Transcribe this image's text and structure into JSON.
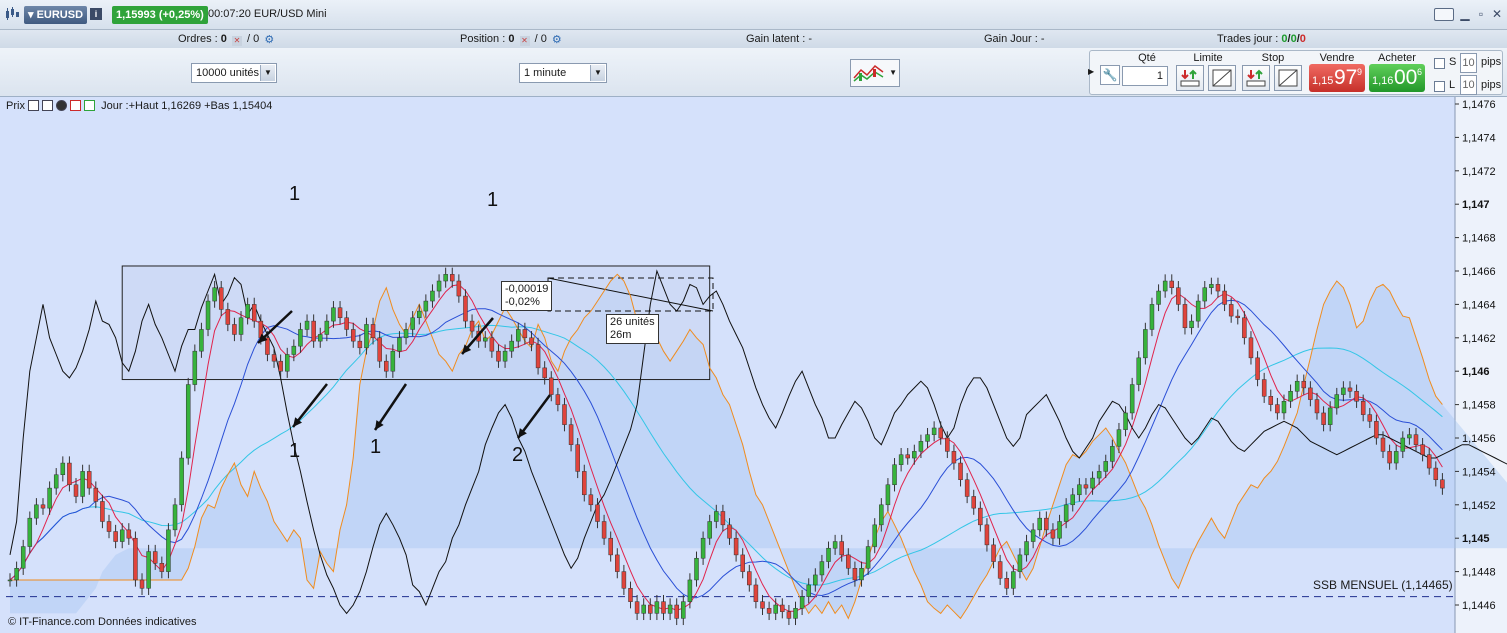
{
  "window": {
    "symbol": "EURUSD",
    "price_badge": "1,15993 (+0,25%)",
    "time_title": "00:07:20 EUR/USD Mini",
    "colors": {
      "up": "#2fa33a",
      "down": "#cc2a2a"
    }
  },
  "status": {
    "orders_label": "Ordres :",
    "orders_a": "0",
    "orders_sep": "/",
    "orders_b": "0",
    "position_label": "Position :",
    "position_a": "0",
    "position_sep": "/",
    "position_b": "0",
    "latent_label": "Gain latent :",
    "latent_value": "-",
    "day_gain_label": "Gain Jour :",
    "day_gain_value": "-",
    "trades_label": "Trades jour :",
    "trades_a": "0",
    "trades_b": "0",
    "trades_c": "0"
  },
  "toolbar": {
    "units_value": "10000 unités",
    "timeframe_value": "1 minute"
  },
  "trade": {
    "qty_label": "Qté",
    "qty_value": "1",
    "limit_label": "Limite",
    "stop_label": "Stop",
    "sell_label": "Vendre",
    "buy_label": "Acheter",
    "sell_prefix": "1,15",
    "sell_big": "97",
    "sell_sup": "9",
    "buy_prefix": "1,16",
    "buy_big": "00",
    "buy_sup": "6",
    "s_label": "S",
    "l_label": "L",
    "pips_value": "10",
    "pips_label": "pips"
  },
  "chart_header": {
    "title": "Prix",
    "day_info": "Jour :+Haut 1,16269 +Bas 1,15404"
  },
  "annotations": {
    "label_1": "1",
    "label_2": "2",
    "tip_top_1": "-0,00019",
    "tip_top_2": "-0,02%",
    "tip_bottom_1": "26 unités",
    "tip_bottom_2": "26m",
    "ssb_label": "SSB MENSUEL (1,14465)",
    "source": "© IT-Finance.com Données indicatives"
  },
  "chart_data": {
    "type": "candlestick",
    "title": "EURUSD",
    "xlabel": "",
    "ylabel": "",
    "ylim": [
      1.14455,
      1.14765
    ],
    "y_ticks": [
      {
        "v": 1.1476,
        "label": "1,1476",
        "bold": false
      },
      {
        "v": 1.1474,
        "label": "1,1474",
        "bold": false
      },
      {
        "v": 1.1472,
        "label": "1,1472",
        "bold": false
      },
      {
        "v": 1.147,
        "label": "1,147",
        "bold": true
      },
      {
        "v": 1.1468,
        "label": "1,1468",
        "bold": false
      },
      {
        "v": 1.1466,
        "label": "1,1466",
        "bold": false
      },
      {
        "v": 1.1464,
        "label": "1,1464",
        "bold": false
      },
      {
        "v": 1.1462,
        "label": "1,1462",
        "bold": false
      },
      {
        "v": 1.146,
        "label": "1,146",
        "bold": true
      },
      {
        "v": 1.1458,
        "label": "1,1458",
        "bold": false
      },
      {
        "v": 1.1456,
        "label": "1,1456",
        "bold": false
      },
      {
        "v": 1.1454,
        "label": "1,1454",
        "bold": false
      },
      {
        "v": 1.1452,
        "label": "1,1452",
        "bold": false
      },
      {
        "v": 1.145,
        "label": "1,145",
        "bold": true
      },
      {
        "v": 1.1448,
        "label": "1,1448",
        "bold": false
      },
      {
        "v": 1.1446,
        "label": "1,1446",
        "bold": false
      }
    ],
    "reference_line": {
      "value": 1.14465,
      "label": "SSB MENSUEL (1,14465)"
    },
    "range_box": {
      "x_start": 17,
      "x_end": 106,
      "y_top": 1.14663,
      "y_bottom": 1.14595
    },
    "closes": [
      1.14475,
      1.14482,
      1.14495,
      1.14512,
      1.1452,
      1.14518,
      1.1453,
      1.14538,
      1.14545,
      1.14532,
      1.14525,
      1.1454,
      1.1453,
      1.14522,
      1.1451,
      1.14504,
      1.14498,
      1.14505,
      1.145,
      1.14475,
      1.1447,
      1.14492,
      1.14485,
      1.1448,
      1.14505,
      1.1452,
      1.14548,
      1.14592,
      1.14612,
      1.14625,
      1.14642,
      1.1465,
      1.14637,
      1.14628,
      1.14622,
      1.14632,
      1.1464,
      1.1463,
      1.1462,
      1.1461,
      1.14606,
      1.146,
      1.1461,
      1.14615,
      1.14625,
      1.1463,
      1.14618,
      1.14622,
      1.1463,
      1.14638,
      1.14632,
      1.14625,
      1.14618,
      1.14614,
      1.14628,
      1.1462,
      1.14606,
      1.146,
      1.14612,
      1.1462,
      1.14625,
      1.14632,
      1.14636,
      1.14642,
      1.14648,
      1.14654,
      1.14658,
      1.14654,
      1.14645,
      1.1463,
      1.14624,
      1.14618,
      1.1462,
      1.14612,
      1.14606,
      1.14612,
      1.14618,
      1.14625,
      1.1462,
      1.14616,
      1.14602,
      1.14596,
      1.14586,
      1.1458,
      1.14568,
      1.14556,
      1.1454,
      1.14526,
      1.1452,
      1.1451,
      1.145,
      1.1449,
      1.1448,
      1.1447,
      1.14462,
      1.14455,
      1.1446,
      1.14455,
      1.14462,
      1.14455,
      1.1446,
      1.14452,
      1.14462,
      1.14475,
      1.14488,
      1.145,
      1.1451,
      1.14516,
      1.14508,
      1.145,
      1.1449,
      1.1448,
      1.14472,
      1.14462,
      1.14458,
      1.14455,
      1.1446,
      1.14456,
      1.14452,
      1.14458,
      1.14465,
      1.14472,
      1.14478,
      1.14486,
      1.14494,
      1.14498,
      1.1449,
      1.14482,
      1.14475,
      1.14482,
      1.14495,
      1.14508,
      1.1452,
      1.14532,
      1.14544,
      1.1455,
      1.14548,
      1.14552,
      1.14558,
      1.14562,
      1.14566,
      1.1456,
      1.14552,
      1.14545,
      1.14535,
      1.14525,
      1.14518,
      1.14508,
      1.14496,
      1.14486,
      1.14476,
      1.1447,
      1.1448,
      1.1449,
      1.14498,
      1.14505,
      1.14512,
      1.14505,
      1.145,
      1.1451,
      1.1452,
      1.14526,
      1.14532,
      1.1453,
      1.14536,
      1.1454,
      1.14546,
      1.14555,
      1.14565,
      1.14575,
      1.14592,
      1.14608,
      1.14625,
      1.1464,
      1.14648,
      1.14654,
      1.1465,
      1.1464,
      1.14626,
      1.1463,
      1.14642,
      1.1465,
      1.14652,
      1.14648,
      1.1464,
      1.14633,
      1.14632,
      1.1462,
      1.14608,
      1.14595,
      1.14585,
      1.1458,
      1.14575,
      1.14582,
      1.14588,
      1.14594,
      1.1459,
      1.14583,
      1.14575,
      1.14568,
      1.14578,
      1.14586,
      1.1459,
      1.14588,
      1.14582,
      1.14574,
      1.1457,
      1.1456,
      1.14552,
      1.14545,
      1.14552,
      1.1456,
      1.14562,
      1.14556,
      1.1455,
      1.14542,
      1.14535,
      1.1453
    ],
    "black_line": [
      1.1449,
      1.1451,
      1.1456,
      1.146,
      1.1462,
      1.1464,
      1.1462,
      1.1461,
      1.146,
      1.14596,
      1.14602,
      1.14612,
      1.14625,
      1.14642,
      1.1463,
      1.14628,
      1.1462,
      1.14605,
      1.146,
      1.14612,
      1.1463,
      1.1464,
      1.14628,
      1.1462,
      1.1461,
      1.146,
      1.14615,
      1.14625,
      1.14625,
      1.14638,
      1.14648,
      1.14658,
      1.1464,
      1.14646,
      1.14656,
      1.14652,
      1.14634,
      1.1464,
      1.1463,
      1.14622,
      1.14614,
      1.14596,
      1.14575,
      1.14556,
      1.1454,
      1.14522,
      1.14505,
      1.1449,
      1.14478,
      1.1447,
      1.1446,
      1.14455,
      1.1446,
      1.14468,
      1.1448,
      1.14495,
      1.14508,
      1.14515,
      1.14508,
      1.145,
      1.1449,
      1.14472,
      1.14468,
      1.1446,
      1.1447,
      1.1448,
      1.14486,
      1.145,
      1.14508,
      1.1452,
      1.1453,
      1.1454,
      1.14556,
      1.14566,
      1.14575,
      1.1458,
      1.14572,
      1.1456,
      1.14552,
      1.1454,
      1.1453,
      1.1452,
      1.1451,
      1.145,
      1.1449,
      1.14482,
      1.14488,
      1.145,
      1.1451,
      1.1452,
      1.14526,
      1.14535,
      1.14545,
      1.14555,
      1.14565,
      1.1458,
      1.1461,
      1.1464,
      1.1466,
      1.1465,
      1.1464,
      1.14636,
      1.14642,
      1.14652,
      1.1465,
      1.1464,
      1.14645,
      1.14648,
      1.1464,
      1.1463,
      1.14622,
      1.14614,
      1.14602,
      1.1459,
      1.1458,
      1.14572,
      1.14566,
      1.14575,
      1.14585,
      1.14594,
      1.146,
      1.1459,
      1.1458,
      1.14572,
      1.1456,
      1.1456,
      1.14568,
      1.14575,
      1.14582,
      1.14578,
      1.1457,
      1.1456,
      1.14556,
      1.14565,
      1.14575,
      1.1458,
      1.14586,
      1.1459,
      1.14594,
      1.1459,
      1.1458,
      1.14568,
      1.1456,
      1.14566,
      1.1458,
      1.1459,
      1.14596,
      1.14596,
      1.1459,
      1.1458,
      1.1457,
      1.1456,
      1.14555,
      1.1456,
      1.14574,
      1.14578,
      1.14582,
      1.14586,
      1.14578,
      1.1457,
      1.1456,
      1.14552,
      1.14548,
      1.14554,
      1.1456,
      1.1457,
      1.14576,
      1.14582,
      1.1458,
      1.14574,
      1.14566,
      1.1456,
      1.14566,
      1.14574,
      1.1458,
      1.14578,
      1.14572,
      1.14566,
      1.1456,
      1.14556,
      1.1456,
      1.14566,
      1.14572,
      1.1457,
      1.14564,
      1.14558,
      1.14554,
      1.14552,
      1.14556,
      1.1456,
      1.14564,
      1.14566,
      1.14568,
      1.1457,
      1.14568,
      1.14566,
      1.14562,
      1.14558,
      1.14556,
      1.14554,
      1.14552,
      1.1455,
      1.14552,
      1.14554,
      1.14556,
      1.14558,
      1.1456,
      1.14562,
      1.14562,
      1.1456,
      1.14558,
      1.14556,
      1.14554,
      1.14552,
      1.1455,
      1.14548,
      1.14548,
      1.1455,
      1.14552,
      1.14554,
      1.14556,
      1.14556,
      1.14554,
      1.14552,
      1.1455,
      1.14548,
      1.14546,
      1.14544,
      1.14542,
      1.1454,
      1.14538,
      1.14536,
      1.14534
    ],
    "cloud_a": [
      1.14455,
      1.14455,
      1.14455,
      1.14455,
      1.14455,
      1.14455,
      1.14455,
      1.14455,
      1.14455,
      1.14455,
      1.14455,
      1.1446,
      1.14465,
      1.1447,
      1.1448,
      1.14485,
      1.1449,
      1.14492,
      1.14494,
      1.14494,
      1.14494,
      1.14494,
      1.14494,
      1.14494,
      1.14494,
      1.14494,
      1.14494,
      1.14494,
      1.14494,
      1.14494,
      1.14494,
      1.14494,
      1.14494,
      1.14494,
      1.14494,
      1.14494,
      1.14494,
      1.14494,
      1.14494,
      1.14494,
      1.14494,
      1.14494,
      1.14494,
      1.14494,
      1.14494,
      1.14494,
      1.14494,
      1.14494,
      1.14494,
      1.14494,
      1.14494,
      1.14494,
      1.14494,
      1.14494,
      1.14494,
      1.14494,
      1.14494,
      1.14494,
      1.14494,
      1.14494,
      1.14494,
      1.14494,
      1.14494,
      1.14494,
      1.14494,
      1.14494,
      1.14494,
      1.14494,
      1.14494,
      1.14494,
      1.14494,
      1.14494,
      1.14494,
      1.14494,
      1.14494,
      1.14494,
      1.14494,
      1.14494,
      1.14494,
      1.14494,
      1.14494,
      1.14494,
      1.14494,
      1.14494,
      1.14494,
      1.14494,
      1.14494,
      1.14494,
      1.14494,
      1.14494,
      1.14494,
      1.14494,
      1.14494,
      1.14494,
      1.14494,
      1.14494,
      1.14494,
      1.14494,
      1.14494,
      1.14494,
      1.14494,
      1.14494,
      1.14494,
      1.14494,
      1.14494,
      1.14494,
      1.14494,
      1.14494,
      1.14494,
      1.14494,
      1.14494,
      1.14494,
      1.14494,
      1.14494,
      1.14494,
      1.14494,
      1.14494,
      1.14494,
      1.14494,
      1.14494,
      1.14494,
      1.14494,
      1.14494,
      1.14494,
      1.14494,
      1.14494,
      1.14494,
      1.14494,
      1.14494,
      1.14494,
      1.14494,
      1.14494,
      1.14494,
      1.14494,
      1.14494,
      1.14494,
      1.14494,
      1.14494,
      1.14494,
      1.14494,
      1.14494,
      1.14494,
      1.14494,
      1.14494,
      1.14494,
      1.14494,
      1.14494,
      1.14494,
      1.14494,
      1.14494,
      1.14494,
      1.14494,
      1.14494,
      1.14494,
      1.14494,
      1.14494,
      1.14494,
      1.14494,
      1.14494,
      1.14494,
      1.14494,
      1.14494,
      1.14494,
      1.14494,
      1.14494,
      1.14494,
      1.14494,
      1.14494,
      1.14494,
      1.14494,
      1.14494,
      1.14494,
      1.14494,
      1.14494,
      1.14494,
      1.14494,
      1.14494,
      1.14494,
      1.14494,
      1.14494,
      1.14494,
      1.14494,
      1.14494,
      1.14494,
      1.14494,
      1.14494,
      1.14494,
      1.14494,
      1.14494,
      1.14494,
      1.14494,
      1.14494,
      1.14494,
      1.14494,
      1.14494,
      1.14494,
      1.14494,
      1.14494,
      1.14494,
      1.14494,
      1.14494,
      1.14494,
      1.14494,
      1.14494,
      1.14494,
      1.14494,
      1.14494,
      1.14494,
      1.14494,
      1.14494,
      1.14494,
      1.14494,
      1.14494,
      1.14494,
      1.14494,
      1.14494,
      1.14494,
      1.14494,
      1.14494,
      1.14494,
      1.14494,
      1.14494,
      1.14494,
      1.14494,
      1.14494,
      1.14494,
      1.14494,
      1.14494,
      1.14494,
      1.14494,
      1.14494,
      1.14494,
      1.14494,
      1.14494,
      1.14494,
      1.14494
    ]
  }
}
